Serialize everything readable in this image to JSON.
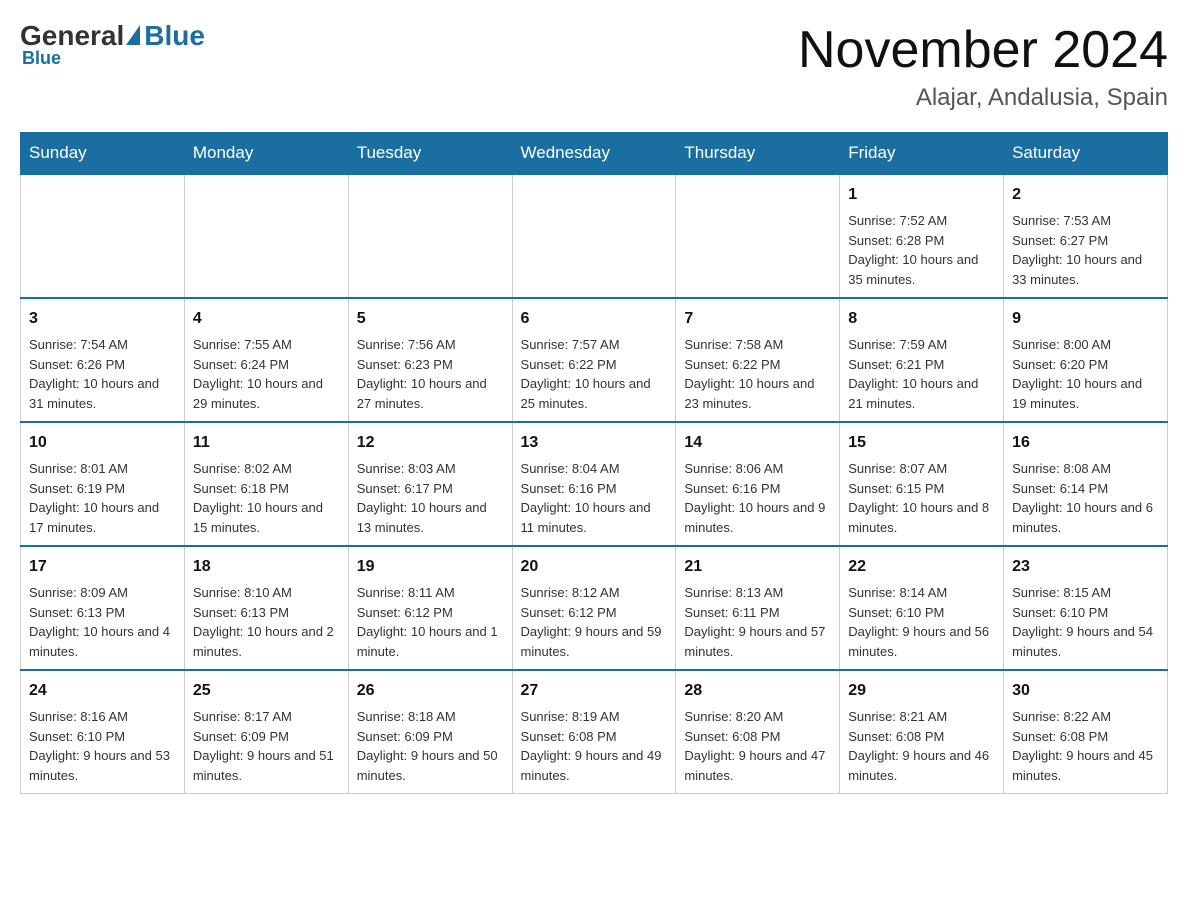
{
  "header": {
    "logo_general": "General",
    "logo_blue": "Blue",
    "month_title": "November 2024",
    "location": "Alajar, Andalusia, Spain"
  },
  "days_of_week": [
    "Sunday",
    "Monday",
    "Tuesday",
    "Wednesday",
    "Thursday",
    "Friday",
    "Saturday"
  ],
  "weeks": [
    [
      {
        "day": "",
        "info": ""
      },
      {
        "day": "",
        "info": ""
      },
      {
        "day": "",
        "info": ""
      },
      {
        "day": "",
        "info": ""
      },
      {
        "day": "",
        "info": ""
      },
      {
        "day": "1",
        "info": "Sunrise: 7:52 AM\nSunset: 6:28 PM\nDaylight: 10 hours and 35 minutes."
      },
      {
        "day": "2",
        "info": "Sunrise: 7:53 AM\nSunset: 6:27 PM\nDaylight: 10 hours and 33 minutes."
      }
    ],
    [
      {
        "day": "3",
        "info": "Sunrise: 7:54 AM\nSunset: 6:26 PM\nDaylight: 10 hours and 31 minutes."
      },
      {
        "day": "4",
        "info": "Sunrise: 7:55 AM\nSunset: 6:24 PM\nDaylight: 10 hours and 29 minutes."
      },
      {
        "day": "5",
        "info": "Sunrise: 7:56 AM\nSunset: 6:23 PM\nDaylight: 10 hours and 27 minutes."
      },
      {
        "day": "6",
        "info": "Sunrise: 7:57 AM\nSunset: 6:22 PM\nDaylight: 10 hours and 25 minutes."
      },
      {
        "day": "7",
        "info": "Sunrise: 7:58 AM\nSunset: 6:22 PM\nDaylight: 10 hours and 23 minutes."
      },
      {
        "day": "8",
        "info": "Sunrise: 7:59 AM\nSunset: 6:21 PM\nDaylight: 10 hours and 21 minutes."
      },
      {
        "day": "9",
        "info": "Sunrise: 8:00 AM\nSunset: 6:20 PM\nDaylight: 10 hours and 19 minutes."
      }
    ],
    [
      {
        "day": "10",
        "info": "Sunrise: 8:01 AM\nSunset: 6:19 PM\nDaylight: 10 hours and 17 minutes."
      },
      {
        "day": "11",
        "info": "Sunrise: 8:02 AM\nSunset: 6:18 PM\nDaylight: 10 hours and 15 minutes."
      },
      {
        "day": "12",
        "info": "Sunrise: 8:03 AM\nSunset: 6:17 PM\nDaylight: 10 hours and 13 minutes."
      },
      {
        "day": "13",
        "info": "Sunrise: 8:04 AM\nSunset: 6:16 PM\nDaylight: 10 hours and 11 minutes."
      },
      {
        "day": "14",
        "info": "Sunrise: 8:06 AM\nSunset: 6:16 PM\nDaylight: 10 hours and 9 minutes."
      },
      {
        "day": "15",
        "info": "Sunrise: 8:07 AM\nSunset: 6:15 PM\nDaylight: 10 hours and 8 minutes."
      },
      {
        "day": "16",
        "info": "Sunrise: 8:08 AM\nSunset: 6:14 PM\nDaylight: 10 hours and 6 minutes."
      }
    ],
    [
      {
        "day": "17",
        "info": "Sunrise: 8:09 AM\nSunset: 6:13 PM\nDaylight: 10 hours and 4 minutes."
      },
      {
        "day": "18",
        "info": "Sunrise: 8:10 AM\nSunset: 6:13 PM\nDaylight: 10 hours and 2 minutes."
      },
      {
        "day": "19",
        "info": "Sunrise: 8:11 AM\nSunset: 6:12 PM\nDaylight: 10 hours and 1 minute."
      },
      {
        "day": "20",
        "info": "Sunrise: 8:12 AM\nSunset: 6:12 PM\nDaylight: 9 hours and 59 minutes."
      },
      {
        "day": "21",
        "info": "Sunrise: 8:13 AM\nSunset: 6:11 PM\nDaylight: 9 hours and 57 minutes."
      },
      {
        "day": "22",
        "info": "Sunrise: 8:14 AM\nSunset: 6:10 PM\nDaylight: 9 hours and 56 minutes."
      },
      {
        "day": "23",
        "info": "Sunrise: 8:15 AM\nSunset: 6:10 PM\nDaylight: 9 hours and 54 minutes."
      }
    ],
    [
      {
        "day": "24",
        "info": "Sunrise: 8:16 AM\nSunset: 6:10 PM\nDaylight: 9 hours and 53 minutes."
      },
      {
        "day": "25",
        "info": "Sunrise: 8:17 AM\nSunset: 6:09 PM\nDaylight: 9 hours and 51 minutes."
      },
      {
        "day": "26",
        "info": "Sunrise: 8:18 AM\nSunset: 6:09 PM\nDaylight: 9 hours and 50 minutes."
      },
      {
        "day": "27",
        "info": "Sunrise: 8:19 AM\nSunset: 6:08 PM\nDaylight: 9 hours and 49 minutes."
      },
      {
        "day": "28",
        "info": "Sunrise: 8:20 AM\nSunset: 6:08 PM\nDaylight: 9 hours and 47 minutes."
      },
      {
        "day": "29",
        "info": "Sunrise: 8:21 AM\nSunset: 6:08 PM\nDaylight: 9 hours and 46 minutes."
      },
      {
        "day": "30",
        "info": "Sunrise: 8:22 AM\nSunset: 6:08 PM\nDaylight: 9 hours and 45 minutes."
      }
    ]
  ]
}
